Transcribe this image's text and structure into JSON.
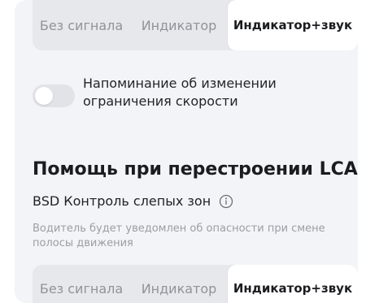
{
  "top_selector": {
    "options": [
      "Без сигнала",
      "Индикатор",
      "Индикатор+звук"
    ],
    "selected": "Индикатор+звук"
  },
  "speed_limit_toggle": {
    "label": "Напоминание об изменении ограничения скорости",
    "state": "off"
  },
  "lca_section": {
    "title": "Помощь при перестроении LCA",
    "feature_label": "BSD Контроль слепых зон",
    "feature_icon": "info-icon",
    "description": "Водитель будет уведомлен об опасности при смене полосы движения"
  },
  "bottom_selector": {
    "options": [
      "Без сигнала",
      "Индикатор",
      "Индикатор+звук"
    ],
    "selected": "Индикатор+звук"
  },
  "colors": {
    "panel_bg": "#f3f4f7",
    "segment_bg": "#e7e8ec",
    "segment_active_bg": "#ffffff",
    "muted_text": "#8f9399",
    "toggle_off": "#e2e3e8"
  }
}
